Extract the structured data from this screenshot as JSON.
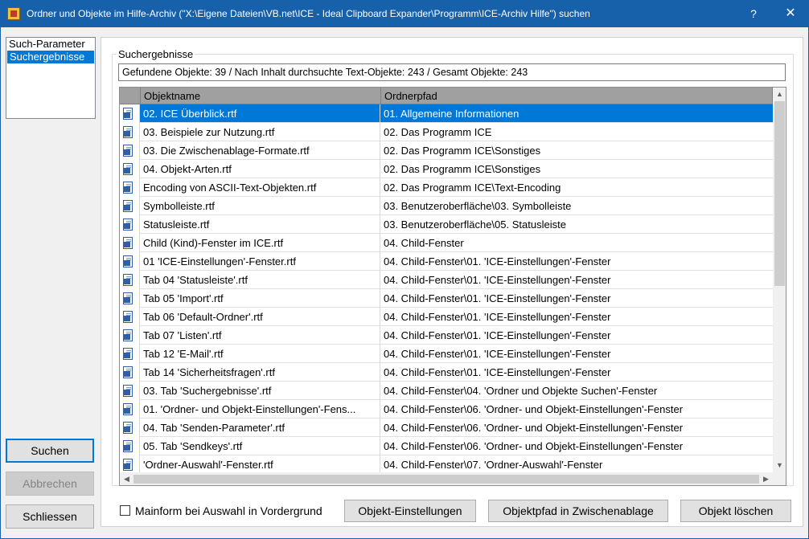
{
  "window": {
    "title": "Ordner und Objekte im Hilfe-Archiv (\"X:\\Eigene Dateien\\VB.net\\ICE - Ideal Clipboard Expander\\Programm\\ICE-Archiv Hilfe\") suchen",
    "help_label": "?",
    "close_label": "✕"
  },
  "nav": {
    "items": [
      {
        "label": "Such-Parameter",
        "selected": false
      },
      {
        "label": "Suchergebnisse",
        "selected": true
      }
    ]
  },
  "left_buttons": {
    "search": "Suchen",
    "cancel": "Abbrechen",
    "close": "Schliessen"
  },
  "results": {
    "group_title": "Suchergebnisse",
    "summary": "Gefundene Objekte: 39  /  Nach Inhalt durchsuchte Text-Objekte: 243  /  Gesamt Objekte: 243",
    "columns": {
      "name": "Objektname",
      "path": "Ordnerpfad"
    },
    "rows": [
      {
        "name": "02. ICE Überblick.rtf",
        "path": "01. Allgemeine Informationen",
        "selected": true
      },
      {
        "name": "03. Beispiele zur Nutzung.rtf",
        "path": "02. Das Programm ICE"
      },
      {
        "name": "03. Die Zwischenablage-Formate.rtf",
        "path": "02. Das Programm ICE\\Sonstiges"
      },
      {
        "name": "04. Objekt-Arten.rtf",
        "path": "02. Das Programm ICE\\Sonstiges"
      },
      {
        "name": "Encoding von ASCII-Text-Objekten.rtf",
        "path": "02. Das Programm ICE\\Text-Encoding"
      },
      {
        "name": "Symbolleiste.rtf",
        "path": "03. Benutzeroberfläche\\03. Symbolleiste"
      },
      {
        "name": "Statusleiste.rtf",
        "path": "03. Benutzeroberfläche\\05. Statusleiste"
      },
      {
        "name": "Child (Kind)-Fenster im ICE.rtf",
        "path": "04. Child-Fenster"
      },
      {
        "name": "01 'ICE-Einstellungen'-Fenster.rtf",
        "path": "04. Child-Fenster\\01. 'ICE-Einstellungen'-Fenster"
      },
      {
        "name": "Tab 04 'Statusleiste'.rtf",
        "path": "04. Child-Fenster\\01. 'ICE-Einstellungen'-Fenster"
      },
      {
        "name": "Tab 05 'Import'.rtf",
        "path": "04. Child-Fenster\\01. 'ICE-Einstellungen'-Fenster"
      },
      {
        "name": "Tab 06 'Default-Ordner'.rtf",
        "path": "04. Child-Fenster\\01. 'ICE-Einstellungen'-Fenster"
      },
      {
        "name": "Tab 07 'Listen'.rtf",
        "path": "04. Child-Fenster\\01. 'ICE-Einstellungen'-Fenster"
      },
      {
        "name": "Tab 12 'E-Mail'.rtf",
        "path": "04. Child-Fenster\\01. 'ICE-Einstellungen'-Fenster"
      },
      {
        "name": "Tab 14 'Sicherheitsfragen'.rtf",
        "path": "04. Child-Fenster\\01. 'ICE-Einstellungen'-Fenster"
      },
      {
        "name": "03. Tab 'Suchergebnisse'.rtf",
        "path": "04. Child-Fenster\\04. 'Ordner und Objekte Suchen'-Fenster"
      },
      {
        "name": "01. 'Ordner- und Objekt-Einstellungen'-Fens...",
        "path": "04. Child-Fenster\\06. 'Ordner- und Objekt-Einstellungen'-Fenster"
      },
      {
        "name": "04. Tab 'Senden-Parameter'.rtf",
        "path": "04. Child-Fenster\\06. 'Ordner- und Objekt-Einstellungen'-Fenster"
      },
      {
        "name": "05. Tab 'Sendkeys'.rtf",
        "path": "04. Child-Fenster\\06. 'Ordner- und Objekt-Einstellungen'-Fenster"
      },
      {
        "name": "'Ordner-Auswahl'-Fenster.rtf",
        "path": "04. Child-Fenster\\07. 'Ordner-Auswahl'-Fenster"
      }
    ],
    "scroll_up": "▲",
    "scroll_down": "▼",
    "scroll_left": "◀",
    "scroll_right": "▶"
  },
  "footer": {
    "checkbox_label": "Mainform bei Auswahl in Vordergrund",
    "checkbox_checked": false,
    "btn_settings": "Objekt-Einstellungen",
    "btn_copy_path": "Objektpfad in Zwischenablage",
    "btn_delete": "Objekt löschen"
  }
}
